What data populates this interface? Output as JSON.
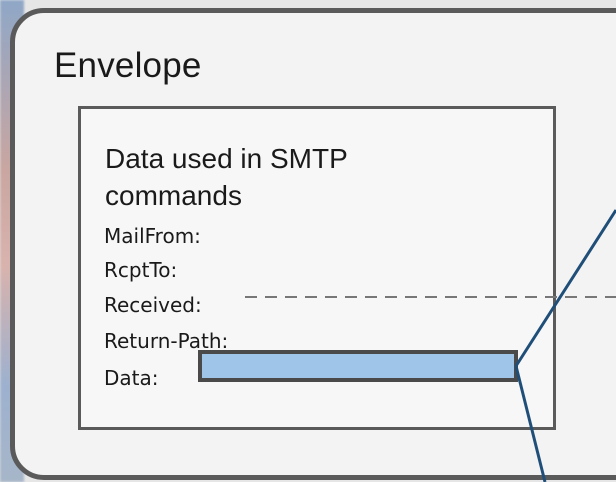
{
  "envelope": {
    "title": "Envelope"
  },
  "data_box": {
    "title": "Data used in SMTP commands"
  },
  "fields": [
    "MailFrom:",
    "RcptTo:",
    "Received:",
    "Return-Path:",
    "Data:"
  ],
  "colors": {
    "border": "#5a5a5a",
    "highlight_fill": "#9fc5e8",
    "connector_line": "#1f4e79",
    "dashed_line": "#777777"
  }
}
